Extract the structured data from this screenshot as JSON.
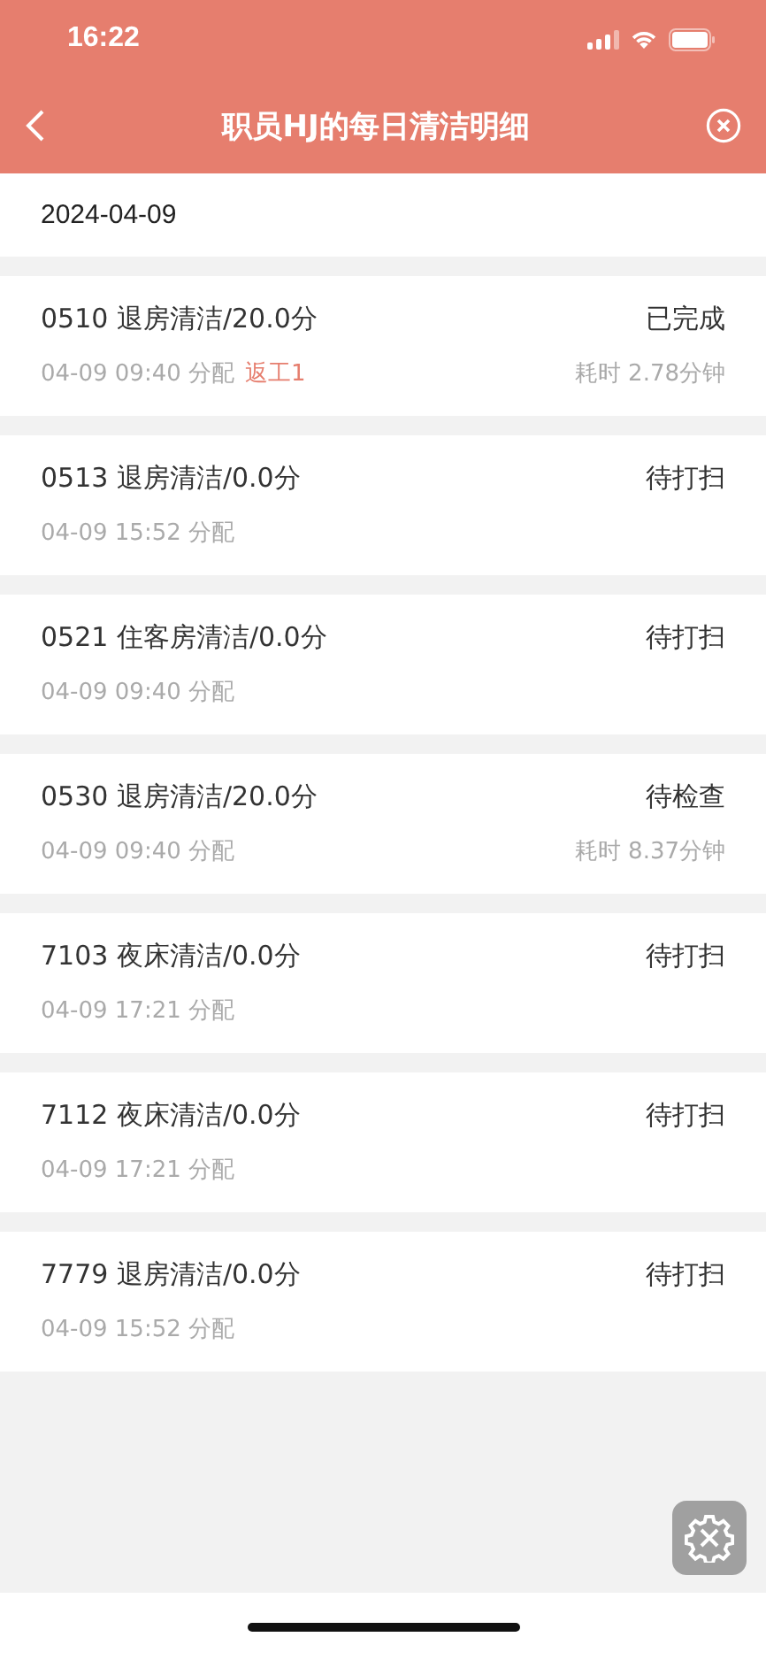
{
  "status_bar": {
    "time": "16:22"
  },
  "nav": {
    "title": "职员HJ的每日清洁明细"
  },
  "date": "2024-04-09",
  "tasks": [
    {
      "title": "0510 退房清洁/20.0分",
      "status": "已完成",
      "assigned": "04-09 09:40 分配",
      "rework": "返工1",
      "duration": "耗时 2.78分钟"
    },
    {
      "title": "0513 退房清洁/0.0分",
      "status": "待打扫",
      "assigned": "04-09 15:52 分配"
    },
    {
      "title": "0521 住客房清洁/0.0分",
      "status": "待打扫",
      "assigned": "04-09 09:40 分配"
    },
    {
      "title": "0530 退房清洁/20.0分",
      "status": "待检查",
      "assigned": "04-09 09:40 分配",
      "duration": "耗时 8.37分钟"
    },
    {
      "title": "7103 夜床清洁/0.0分",
      "status": "待打扫",
      "assigned": "04-09 17:21 分配"
    },
    {
      "title": "7112 夜床清洁/0.0分",
      "status": "待打扫",
      "assigned": "04-09 17:21 分配"
    },
    {
      "title": "7779 退房清洁/0.0分",
      "status": "待打扫",
      "assigned": "04-09 15:52 分配"
    }
  ]
}
